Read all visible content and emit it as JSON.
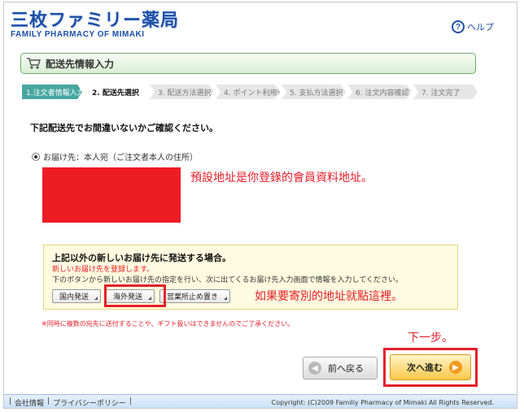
{
  "header": {
    "logo_main": "三枚ファミリー薬局",
    "logo_sub": "FAMILY PHARMACY OF MIMAKI",
    "help_label": "ヘルプ"
  },
  "title_bar": {
    "title": "配送先情報入力"
  },
  "steps": [
    {
      "label": "1.注文者情報入力",
      "state": "done"
    },
    {
      "label": "2. 配送先選択",
      "state": "active"
    },
    {
      "label": "3. 配送方法選択",
      "state": "pending"
    },
    {
      "label": "4. ポイント利用等",
      "state": "pending"
    },
    {
      "label": "5. 支払方法選択",
      "state": "pending"
    },
    {
      "label": "6. 注文内容確認",
      "state": "pending"
    },
    {
      "label": "7. 注文完了",
      "state": "pending"
    }
  ],
  "confirm_text": "下記配送先でお間違いないかご確認ください。",
  "address_option": {
    "label": "お届け先：本人宛（ご注文者本人の住所）",
    "selected": true
  },
  "annotations": {
    "default_address": "預設地址是你登錄的會員資料地址。",
    "other_address": "如果要寄別的地址就點這裡。",
    "next_step": "下一步。"
  },
  "new_address_box": {
    "title": "上記以外の新しいお届け先に発送する場合。",
    "red_note": "新しいお届け先を登録します。",
    "instruction": "下のボタンから新しいお届け先の指定を行い、次に出てくるお届け先入力画面で情報を入力してください。",
    "buttons": {
      "domestic": "国内発送",
      "overseas": "海外発送",
      "office": "営業所止め置き"
    }
  },
  "warning": "※同時に複数の宛先に送付することや、ギフト扱いはできませんのでご了承ください。",
  "nav": {
    "back": "前へ戻る",
    "next": "次へ進む"
  },
  "footer": {
    "company": "会社情報",
    "privacy": "プライバシーポリシー",
    "copyright": "Copyright: (C)2009 Familiy Pharmacy of Mimaki All Rights Reserved."
  },
  "colors": {
    "accent_green": "#48a7a0",
    "annotation_red": "#e4202a",
    "brand_blue": "#1d4fa8"
  }
}
